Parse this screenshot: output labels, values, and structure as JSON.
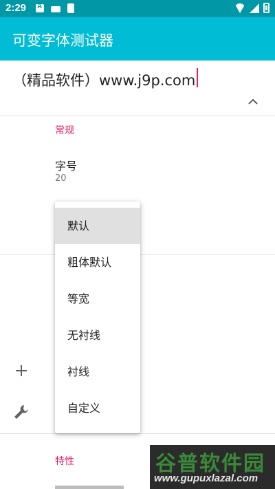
{
  "status_bar": {
    "time": "2:29",
    "left_icons": [
      "a-icon",
      "keyboard-icon",
      "sd-card-icon"
    ],
    "right_icons": [
      "wifi-icon",
      "signal-icon",
      "battery-icon"
    ]
  },
  "app_bar": {
    "title": "可变字体测试器",
    "color": "#00bcd4"
  },
  "preview": {
    "text": "（精品软件）www.j9p.com"
  },
  "general_section": {
    "label": "常规",
    "font_size": {
      "title": "字号",
      "value": "20"
    }
  },
  "font_dropdown": {
    "options": [
      "默认",
      "粗体默认",
      "等宽",
      "无衬线",
      "衬线",
      "自定义"
    ],
    "selected": "默认"
  },
  "features_section": {
    "label": "特性"
  },
  "side_icons": [
    "plus-icon",
    "wrench-icon"
  ],
  "watermark": {
    "main": "谷普软件园",
    "url": "www.gupuxlazal.com"
  },
  "colors": {
    "accent": "#e91e63",
    "primary": "#00bcd4",
    "primary_dark": "#0097a7"
  }
}
